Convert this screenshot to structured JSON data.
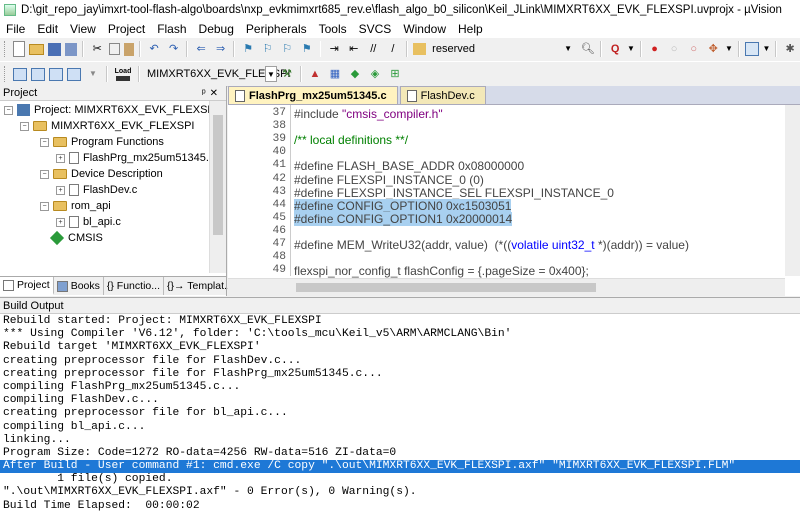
{
  "window": {
    "title": "D:\\git_repo_jay\\imxrt-tool-flash-algo\\boards\\nxp_evkmimxrt685_rev.e\\flash_algo_b0_silicon\\Keil_JLink\\MIMXRT6XX_EVK_FLEXSPI.uvprojx - µVision"
  },
  "menu": [
    "File",
    "Edit",
    "View",
    "Project",
    "Flash",
    "Debug",
    "Peripherals",
    "Tools",
    "SVCS",
    "Window",
    "Help"
  ],
  "toolbar": {
    "find_combo_value": "reserved",
    "target_combo_value": "MIMXRT6XX_EVK_FLEXSPI",
    "load_label": "Load"
  },
  "project_panel": {
    "title": "Project",
    "root": "Project: MIMXRT6XX_EVK_FLEXSPI",
    "target": "MIMXRT6XX_EVK_FLEXSPI",
    "groups": [
      {
        "name": "Program Functions",
        "files": [
          "FlashPrg_mx25um51345.c"
        ]
      },
      {
        "name": "Device Description",
        "files": [
          "FlashDev.c"
        ]
      },
      {
        "name": "rom_api",
        "files": [
          "bl_api.c"
        ]
      }
    ],
    "cmsis": "CMSIS",
    "tabs": [
      "Project",
      "Books",
      "{} Functio...",
      "{}→ Templat..."
    ]
  },
  "editor": {
    "tabs": [
      "FlashPrg_mx25um51345.c",
      "FlashDev.c"
    ],
    "lines": [
      {
        "n": "37",
        "text": "#include \"cmsis_compiler.h\""
      },
      {
        "n": "38",
        "text": ""
      },
      {
        "n": "39",
        "text": "/** local definitions **/"
      },
      {
        "n": "40",
        "text": ""
      },
      {
        "n": "41",
        "text": "#define FLASH_BASE_ADDR 0x08000000"
      },
      {
        "n": "42",
        "text": "#define FLEXSPI_INSTANCE_0 (0)"
      },
      {
        "n": "43",
        "text": "#define FLEXSPI_INSTANCE_SEL FLEXSPI_INSTANCE_0"
      },
      {
        "n": "44",
        "text": "#define CONFIG_OPTION0 0xc1503051"
      },
      {
        "n": "45",
        "text": "#define CONFIG_OPTION1 0x20000014"
      },
      {
        "n": "46",
        "text": ""
      },
      {
        "n": "47",
        "text": "#define MEM_WriteU32(addr, value)  (*((volatile uint32_t *)(addr)) = value)"
      },
      {
        "n": "48",
        "text": ""
      },
      {
        "n": "49",
        "text": "flexspi_nor_config_t flashConfig = {.pageSize = 0x400};"
      }
    ]
  },
  "build_output": {
    "title": "Build Output",
    "lines": [
      "Rebuild started: Project: MIMXRT6XX_EVK_FLEXSPI",
      "*** Using Compiler 'V6.12', folder: 'C:\\tools_mcu\\Keil_v5\\ARM\\ARMCLANG\\Bin'",
      "Rebuild target 'MIMXRT6XX_EVK_FLEXSPI'",
      "creating preprocessor file for FlashDev.c...",
      "creating preprocessor file for FlashPrg_mx25um51345.c...",
      "compiling FlashPrg_mx25um51345.c...",
      "compiling FlashDev.c...",
      "creating preprocessor file for bl_api.c...",
      "compiling bl_api.c...",
      "linking...",
      "Program Size: Code=1272 RO-data=4256 RW-data=516 ZI-data=0",
      "After Build - User command #1: cmd.exe /C copy \".\\out\\MIMXRT6XX_EVK_FLEXSPI.axf\" \"MIMXRT6XX_EVK_FLEXSPI.FLM\"",
      "        1 file(s) copied.",
      "\".\\out\\MIMXRT6XX_EVK_FLEXSPI.axf\" - 0 Error(s), 0 Warning(s).",
      "Build Time Elapsed:  00:00:02"
    ]
  }
}
